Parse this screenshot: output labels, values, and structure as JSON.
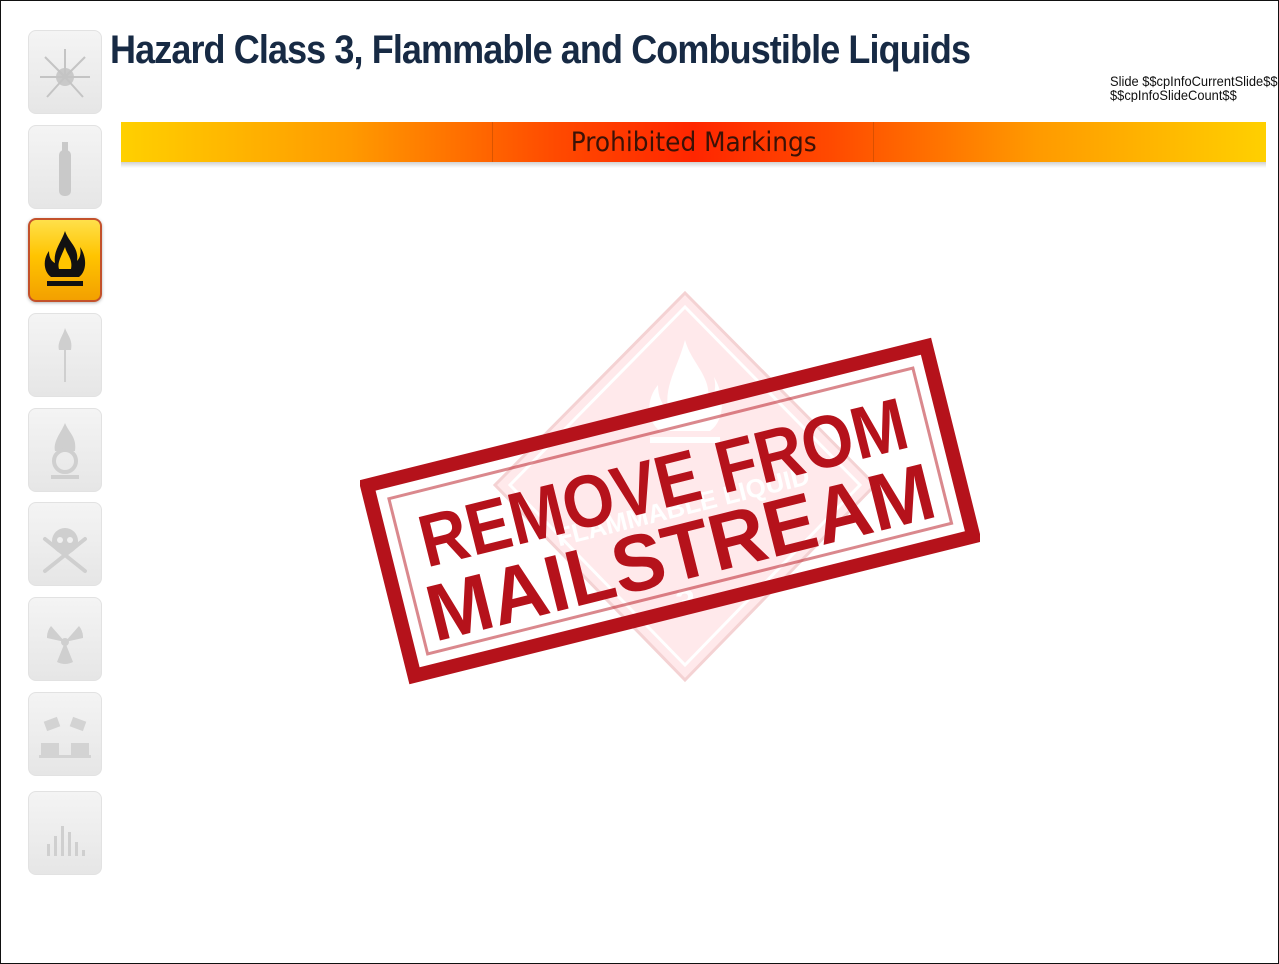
{
  "title": "Hazard Class 3, Flammable and Combustible Liquids",
  "slide_counter": {
    "line1": "Slide $$cpInfoCurrentSlide$$",
    "line2": "$$cpInfoSlideCount$$"
  },
  "subtitle": "Prohibited Markings",
  "sidebar": {
    "items": [
      {
        "icon": "explosive-icon",
        "active": false
      },
      {
        "icon": "gas-cylinder-icon",
        "active": false
      },
      {
        "icon": "flame-icon",
        "active": true
      },
      {
        "icon": "flammable-solid-icon",
        "active": false
      },
      {
        "icon": "oxidizer-icon",
        "active": false
      },
      {
        "icon": "skull-crossbones-icon",
        "active": false
      },
      {
        "icon": "radioactive-icon",
        "active": false
      },
      {
        "icon": "corrosive-icon",
        "active": false
      },
      {
        "icon": "miscellaneous-icon",
        "active": false
      }
    ]
  },
  "stamp": {
    "line1": "REMOVE FROM",
    "line2": "MAILSTREAM",
    "placard_text": "FLAMMABLE LIQUID",
    "placard_number": "3"
  },
  "colors": {
    "title": "#172a44",
    "stamp_red": "#b5121b",
    "active_icon_bg": "#ffc400",
    "bar_center": "#ff2600",
    "bar_edge": "#ffd000"
  }
}
